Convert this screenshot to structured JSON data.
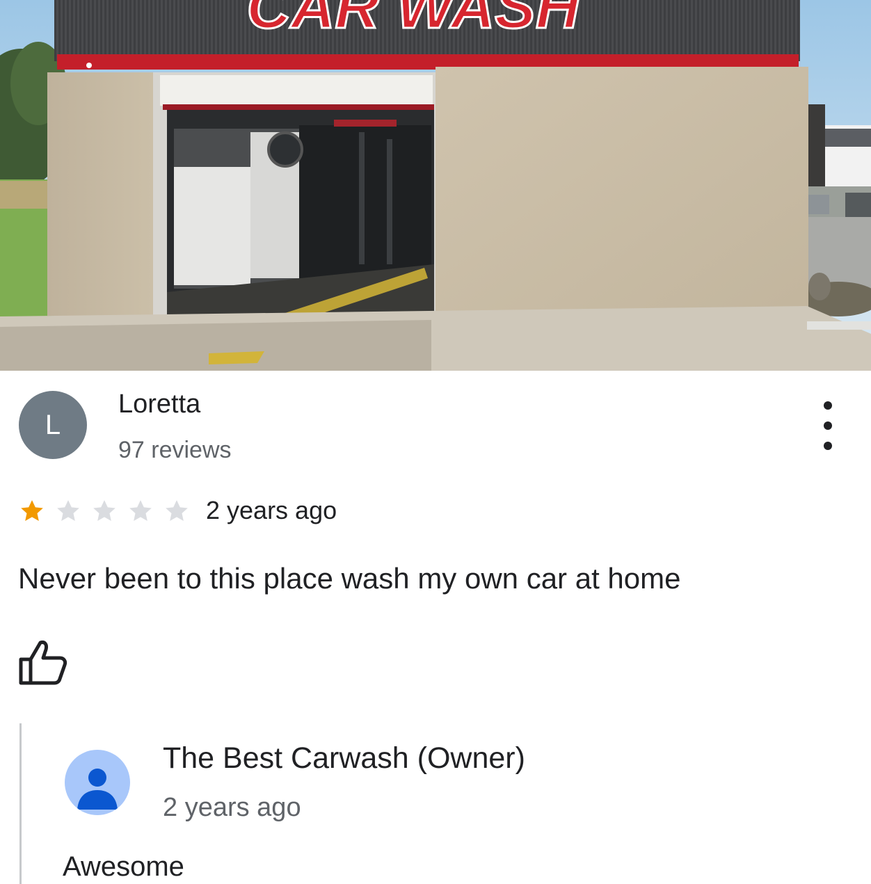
{
  "photo": {
    "description_icon": "car-wash-building-photo",
    "sign_text": "CAR WASH",
    "sign_color": "#d7262f"
  },
  "review": {
    "avatar_letter": "L",
    "avatar_color": "#6f7b85",
    "reviewer_name": "Loretta",
    "reviewer_review_count": "97 reviews",
    "rating": 1,
    "rating_max": 5,
    "star_filled_color": "#f29900",
    "star_empty_color": "#dadce0",
    "time": "2 years ago",
    "text": "Never been to this place wash my own car at home",
    "more_icon": "more-vert-icon",
    "like_icon": "thumbs-up-icon"
  },
  "owner_reply": {
    "avatar_icon": "person-icon",
    "avatar_color": "#a8c7fa",
    "name": "The Best Carwash (Owner)",
    "time": "2 years ago",
    "text": "Awesome"
  }
}
